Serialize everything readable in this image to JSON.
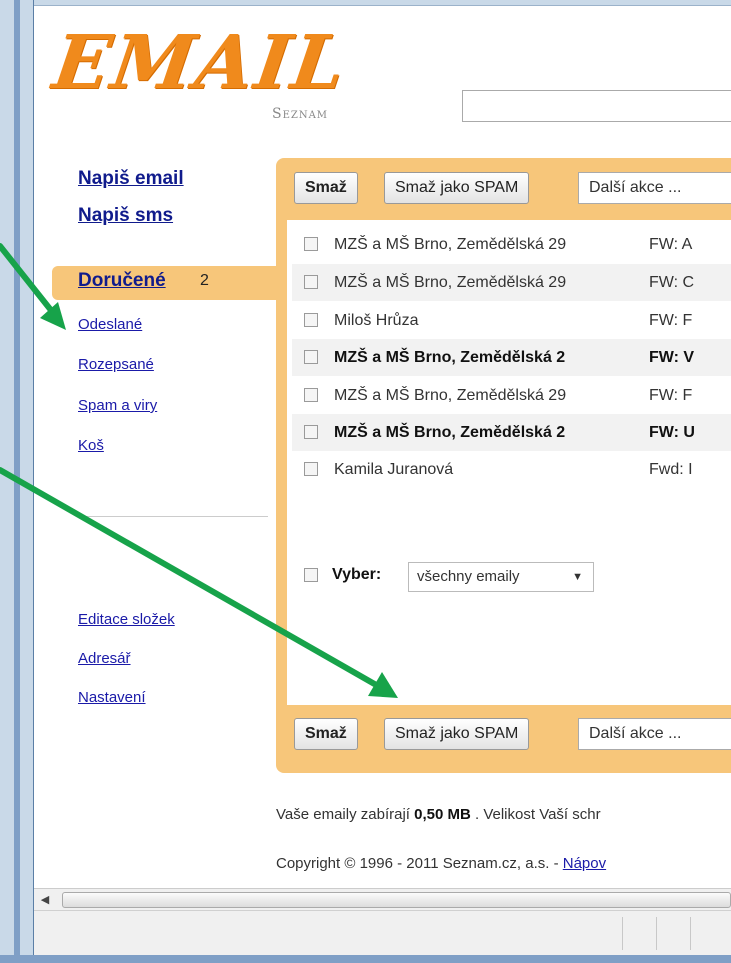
{
  "logo": {
    "brand": "EMAIL",
    "sub": "Seznam"
  },
  "sidebar": {
    "compose_email": "Napiš email",
    "compose_sms": "Napiš sms",
    "inbox_label": "Doručené",
    "inbox_count": "2",
    "folders": [
      "Odeslané",
      "Rozepsané",
      "Spam a viry",
      "Koš"
    ],
    "settings_links": [
      "Editace složek",
      "Adresář",
      "Nastavení"
    ]
  },
  "toolbar": {
    "delete_label": "Smaž",
    "spam_label": "Smaž jako SPAM",
    "more_label": "Další akce ..."
  },
  "messages": [
    {
      "from": "MZŠ a MŠ Brno, Zemědělská 29",
      "subject": "FW: A",
      "unread": false
    },
    {
      "from": "MZŠ a MŠ Brno, Zemědělská 29",
      "subject": "FW: C",
      "unread": false
    },
    {
      "from": "Miloš Hrůza",
      "subject": "FW: F",
      "unread": false
    },
    {
      "from": "MZŠ a MŠ Brno, Zemědělská 2",
      "subject": "FW: V",
      "unread": true
    },
    {
      "from": "MZŠ a MŠ Brno, Zemědělská 29",
      "subject": "FW: F",
      "unread": false
    },
    {
      "from": "MZŠ a MŠ Brno, Zemědělská 2",
      "subject": "FW: U",
      "unread": true
    },
    {
      "from": "Kamila Juranová",
      "subject": "Fwd: I",
      "unread": false
    }
  ],
  "select": {
    "label": "Vyber:",
    "value": "všechny emaily"
  },
  "footer": {
    "usage_prefix": "Vaše emaily zabírají",
    "usage_value": "0,50 MB",
    "usage_suffix": ". Velikost Vaší schr",
    "copyright": "Copyright © 1996 - 2011 Seznam.cz, a.s. -",
    "help_link": "Nápov"
  },
  "colors": {
    "panel": "#f7c67a",
    "arrow": "#17a34a",
    "link": "#101b8c",
    "logo": "#f08a1c"
  }
}
